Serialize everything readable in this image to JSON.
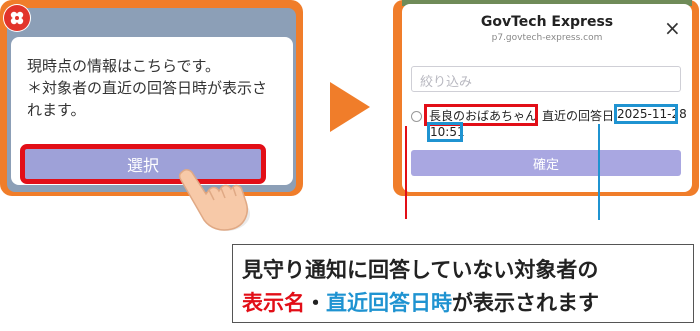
{
  "left_screen": {
    "message_line1": "現時点の情報はこちらです。",
    "message_line2": "＊対象者の直近の回答日時が表示さ",
    "message_line3": "れます。",
    "select_button": "選択",
    "logo_icon": "red-flower-logo-icon",
    "pointer_icon": "pointing-hand-icon"
  },
  "arrow_icon": "orange-right-arrow-icon",
  "right_screen": {
    "title": "GovTech Express",
    "url": "p7.govtech-express.com",
    "close_icon": "×",
    "filter_placeholder": "絞り込み",
    "item": {
      "name": "長良のおばあちゃん",
      "middle": "直近の回答日",
      "date": "2025-11-28",
      "time": "10:51"
    },
    "confirm_button": "確定"
  },
  "caption": {
    "line1": "見守り通知に回答していない対象者の",
    "part_name": "表示名",
    "separator": "・",
    "part_date": "直近回答日時",
    "suffix": "が表示されます"
  },
  "colors": {
    "orange_frame": "#f07d2a",
    "highlight_red": "#e20e17",
    "highlight_blue": "#1f93d1",
    "button_purple": "#a9a7e1"
  }
}
